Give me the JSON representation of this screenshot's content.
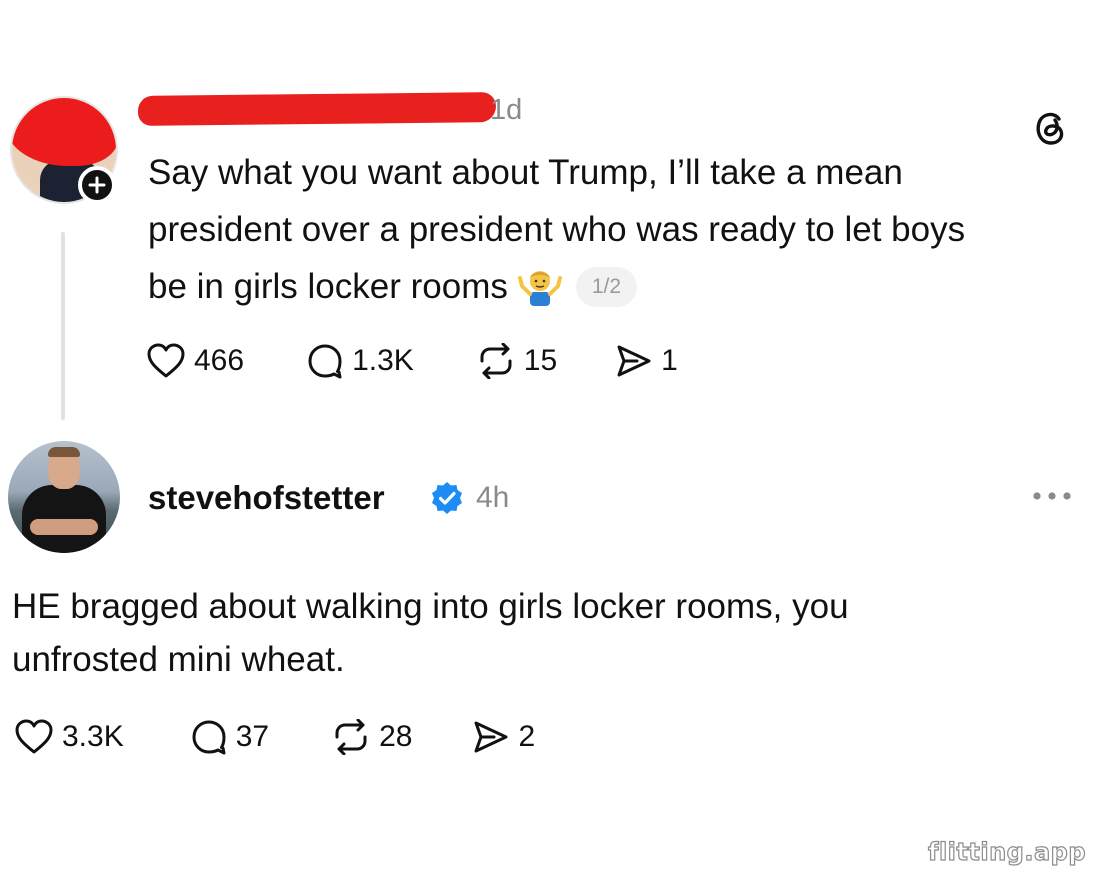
{
  "post": {
    "timestamp": "1d",
    "text_lines": [
      "Say what you want about Trump, I’ll take a mean",
      "president over a president who was ready to let boys",
      "be in girls locker rooms"
    ],
    "emoji": "person-shrugging",
    "page_indicator": "1/2",
    "stats": {
      "likes": "466",
      "replies": "1.3K",
      "reposts": "15",
      "shares": "1"
    }
  },
  "reply": {
    "username": "stevehofstetter",
    "verified": true,
    "timestamp": "4h",
    "text_lines": [
      "HE bragged about walking into girls locker rooms, you",
      "unfrosted mini wheat."
    ],
    "stats": {
      "likes": "3.3K",
      "replies": "37",
      "reposts": "28",
      "shares": "2"
    }
  },
  "watermark": "flitting.app",
  "colors": {
    "redaction": "#e8201e",
    "verified": "#1d8df5",
    "muted_text": "#8a8a8a",
    "text": "#111111"
  },
  "icons": [
    "plus-icon",
    "threads-logo-icon",
    "heart-icon",
    "comment-icon",
    "repost-icon",
    "share-icon",
    "verified-badge-icon",
    "more-options-icon"
  ]
}
